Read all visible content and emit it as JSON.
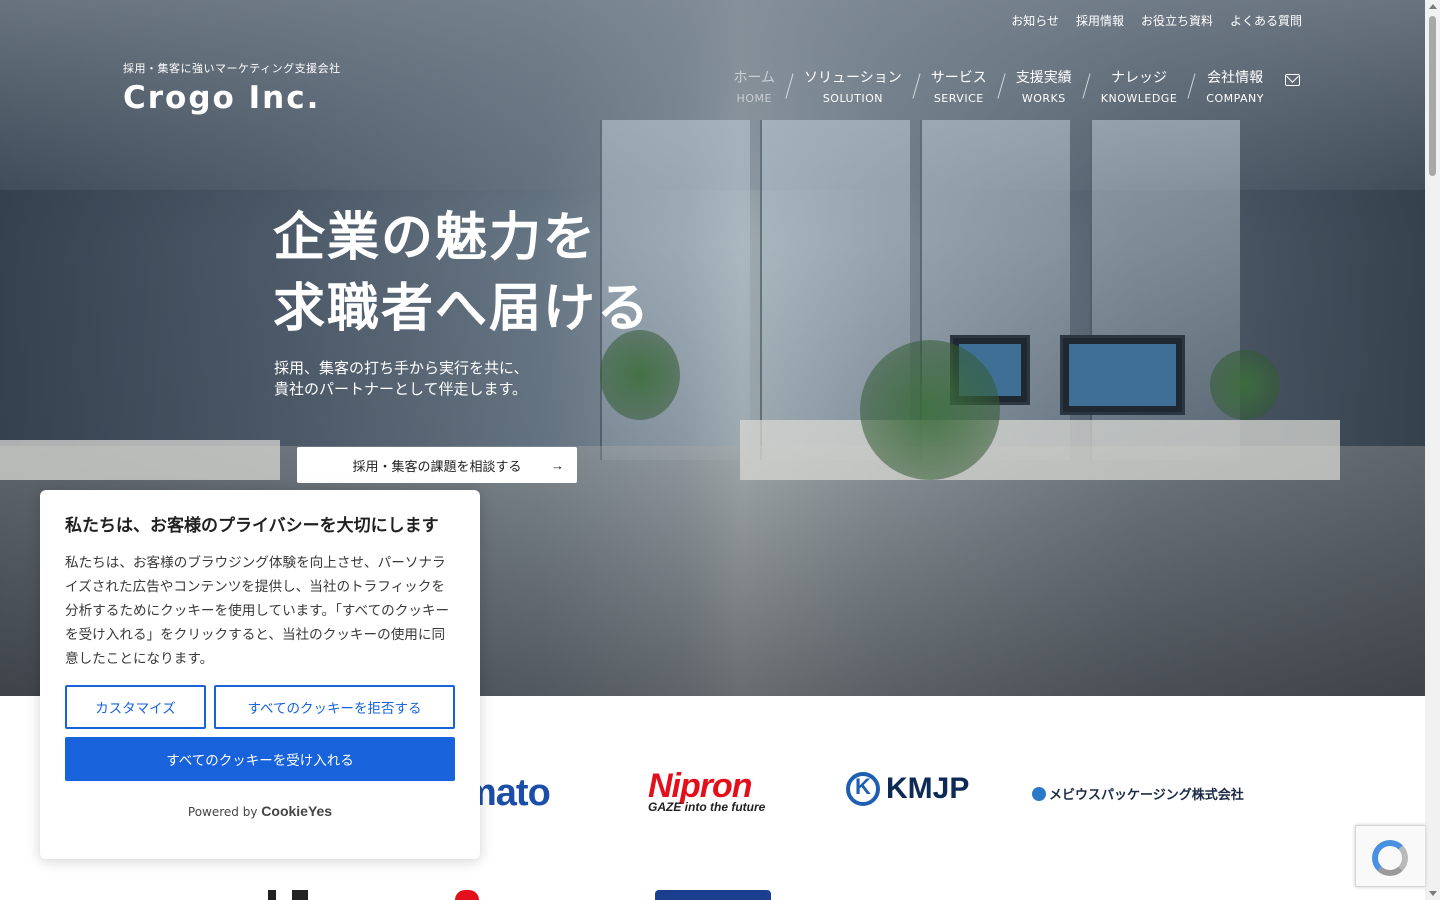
{
  "utility_links": [
    "お知らせ",
    "採用情報",
    "お役立ち資料",
    "よくある質問"
  ],
  "brand": {
    "tagline": "採用・集客に強いマーケティング支援会社",
    "logo": "Crogo Inc."
  },
  "nav": [
    {
      "ja": "ホーム",
      "en": "HOME"
    },
    {
      "ja": "ソリューション",
      "en": "SOLUTION"
    },
    {
      "ja": "サービス",
      "en": "SERVICE"
    },
    {
      "ja": "支援実績",
      "en": "WORKS"
    },
    {
      "ja": "ナレッジ",
      "en": "KNOWLEDGE"
    },
    {
      "ja": "会社情報",
      "en": "COMPANY"
    }
  ],
  "hero": {
    "headline_line1": "企業の魅力を",
    "headline_line2": "求職者へ届ける",
    "sub_line1": "採用、集客の打ち手から実行を共に、",
    "sub_line2": "貴社のパートナーとして伴走します。",
    "cta_label": "採用・集客の課題を相談する",
    "cta_arrow": "→"
  },
  "client_logos": {
    "yamato": "mato",
    "nipron_main": "Nipron",
    "nipron_sub": "GAZE into the future",
    "kmjp": "KMJP",
    "mebius": "メビウスパッケージング株式会社"
  },
  "cookie": {
    "title": "私たちは、お客様のプライバシーを大切にします",
    "body": "私たちは、お客様のブラウジング体験を向上させ、パーソナライズされた広告やコンテンツを提供し、当社のトラフィックを分析するためにクッキーを使用しています。「すべてのクッキーを受け入れる」をクリックすると、当社のクッキーの使用に同意したことになります。",
    "customize_label": "カスタマイズ",
    "reject_label": "すべてのクッキーを拒否する",
    "accept_label": "すべてのクッキーを受け入れる",
    "powered_by": "Powered by",
    "powered_brand": "CookieYes"
  },
  "colors": {
    "accent": "#1863dc",
    "hero_overlay": "#3a4654"
  }
}
